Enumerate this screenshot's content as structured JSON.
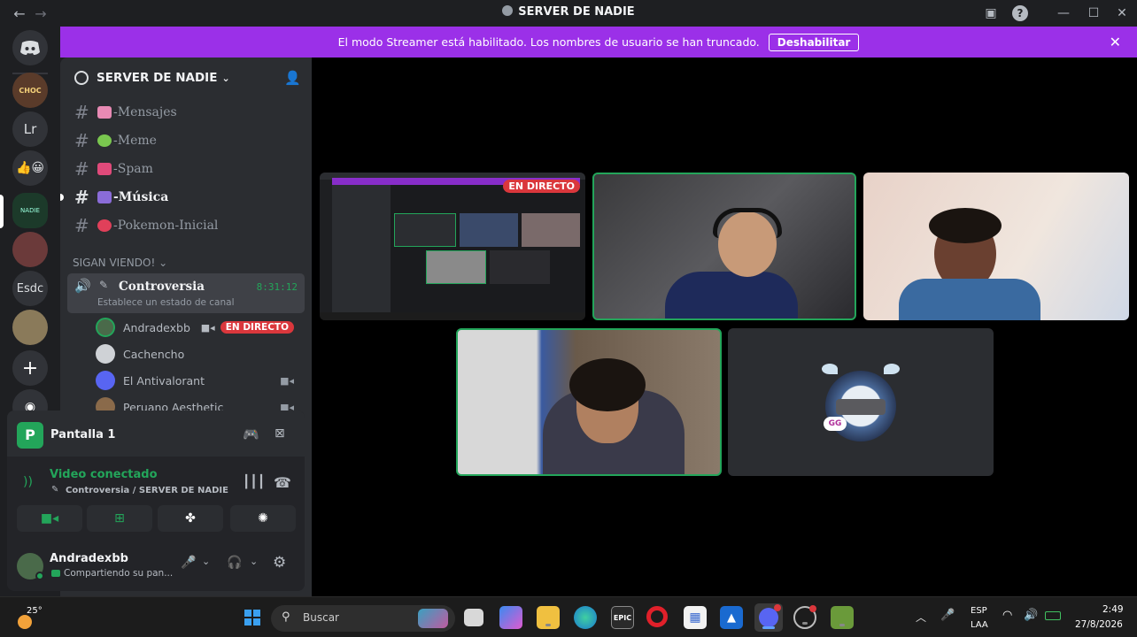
{
  "window": {
    "title": "SERVER DE NADIE"
  },
  "banner": {
    "text": "El modo Streamer está habilitado. Los nombres de usuario se han truncado.",
    "button": "Deshabilitar"
  },
  "guilds": [
    "Lr",
    "Esdc"
  ],
  "server": {
    "name": "SERVER DE NADIE"
  },
  "channels": [
    {
      "name": "-Mensajes",
      "emoji_color": "#e88ab4"
    },
    {
      "name": "-Meme",
      "emoji_color": "#7ac74f"
    },
    {
      "name": "-Spam",
      "emoji_color": "#e04a7a"
    },
    {
      "name": "-Música",
      "emoji_color": "#8a6cd8"
    },
    {
      "name": "-Pokemon-Inicial",
      "emoji_color": "#e0405a"
    }
  ],
  "category": "SIGAN VIENDO!",
  "voice_channel": {
    "name": "Controversia",
    "timer": "8:31:12",
    "status": "Establece un estado de canal"
  },
  "members": [
    {
      "name": "Andradexbb",
      "badge": "EN DIRECTO"
    },
    {
      "name": "Cachencho"
    },
    {
      "name": "El Antivalorant"
    },
    {
      "name": "Peruano Aesthetic"
    }
  ],
  "stream_panel": {
    "title": "Pantalla 1"
  },
  "voice_status": {
    "title": "Video conectado",
    "sub": "Controversia / SERVER DE NADIE"
  },
  "user": {
    "name": "Andradexbb",
    "status": "Compartiendo su pan..."
  },
  "stage": {
    "live_badge": "EN DIRECTO"
  },
  "taskbar": {
    "weather": "25°",
    "search": "Buscar",
    "lang1": "ESP",
    "lang2": "LAA",
    "time": "2:49",
    "date": "27/8/2026"
  },
  "colors": {
    "accent": "#9b30e8",
    "green": "#23a55a",
    "live": "#da373c",
    "blurple": "#5865f2"
  }
}
